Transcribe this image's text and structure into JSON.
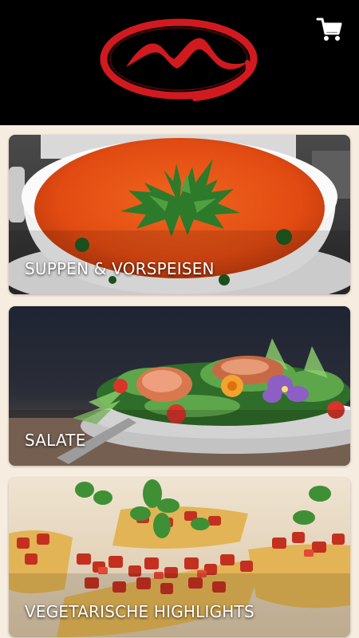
{
  "header": {
    "logo_icon": "brand-logo-m",
    "cart_icon": "shopping-cart-icon",
    "background": "#000000",
    "brand_color": "#d11a1f"
  },
  "categories": [
    {
      "label": "SUPPEN & VORSPEISEN",
      "image": "tomato-soup-bowl"
    },
    {
      "label": "SALATE",
      "image": "salad-plate"
    },
    {
      "label": "VEGETARISCHE HIGHLIGHTS",
      "image": "bruschetta"
    }
  ]
}
